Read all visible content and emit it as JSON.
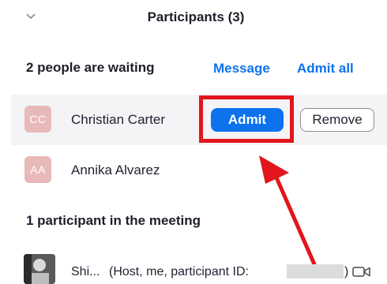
{
  "header": {
    "title": "Participants (3)",
    "collapse_icon": "chevron-down-icon"
  },
  "waiting": {
    "label": "2 people are waiting",
    "message_link": "Message",
    "admit_all_link": "Admit all",
    "people": [
      {
        "initials": "CC",
        "name": "Christian Carter",
        "admit_label": "Admit",
        "remove_label": "Remove"
      },
      {
        "initials": "AA",
        "name": "Annika Alvarez"
      }
    ]
  },
  "meeting": {
    "label": "1 participant in the meeting",
    "host": {
      "name": "Shi...",
      "role_prefix": "(Host, me, participant ID:",
      "role_suffix": ")",
      "camera_icon": "video-camera-icon"
    }
  },
  "colors": {
    "accent": "#0e72ed",
    "highlight": "#e2161c",
    "avatar_bg": "#e8b9b9"
  }
}
